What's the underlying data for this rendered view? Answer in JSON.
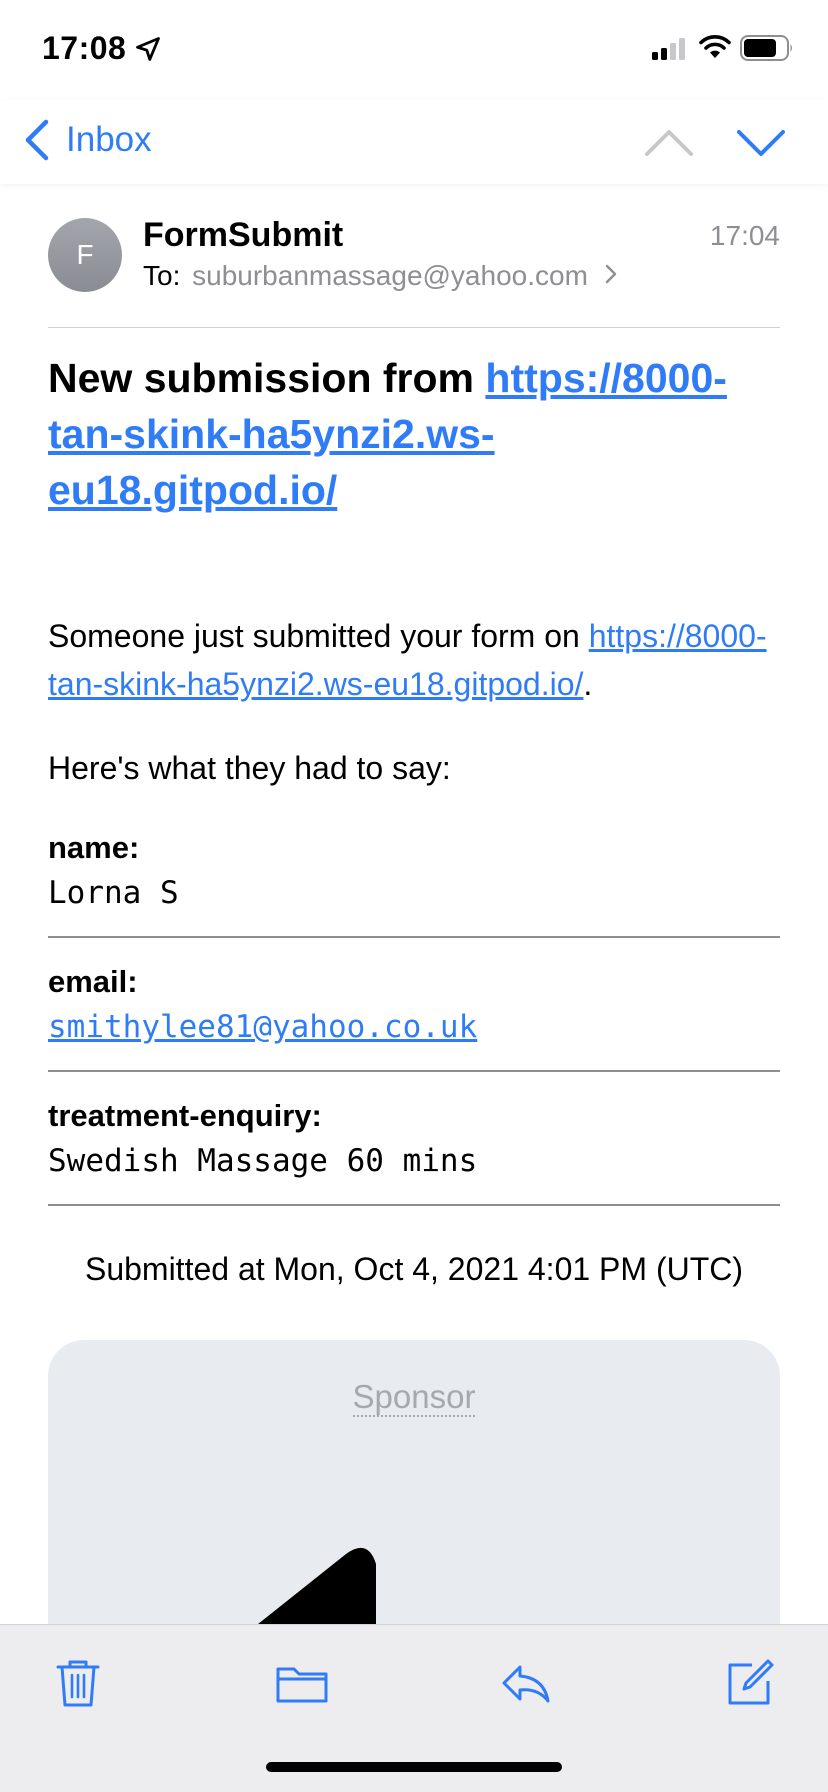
{
  "status_bar": {
    "time": "17:08"
  },
  "nav": {
    "back_label": "Inbox"
  },
  "email": {
    "avatar_initial": "F",
    "sender": "FormSubmit",
    "to_prefix": "To:",
    "to_address": "suburbanmassage@yahoo.com",
    "received_time": "17:04",
    "headline_text": "New submission from ",
    "headline_link": "https://8000-tan-skink-ha5ynzi2.ws-eu18.gitpod.io/",
    "intro_text": "Someone just submitted your form on ",
    "intro_link": "https://8000-tan-skink-ha5ynzi2.ws-eu18.gitpod.io/",
    "intro_end": ".",
    "said_text": "Here's what they had to say:",
    "fields": [
      {
        "label": "name:",
        "value": "Lorna S"
      },
      {
        "label": "email:",
        "value": "smithylee81@yahoo.co.uk"
      },
      {
        "label": "treatment-enquiry:",
        "value": "Swedish Massage 60 mins"
      }
    ],
    "submitted_at": "Submitted at Mon, Oct 4, 2021 4:01 PM (UTC)",
    "sponsor_label": "Sponsor"
  },
  "toolbar": {
    "items": [
      "trash-icon",
      "folder-icon",
      "reply-icon",
      "compose-icon"
    ]
  },
  "colors": {
    "accent": "#2f7cf6",
    "secondary_text": "#8e8e93",
    "toolbar_bg": "#ededef",
    "sponsor_bg": "#e8ebf0"
  }
}
